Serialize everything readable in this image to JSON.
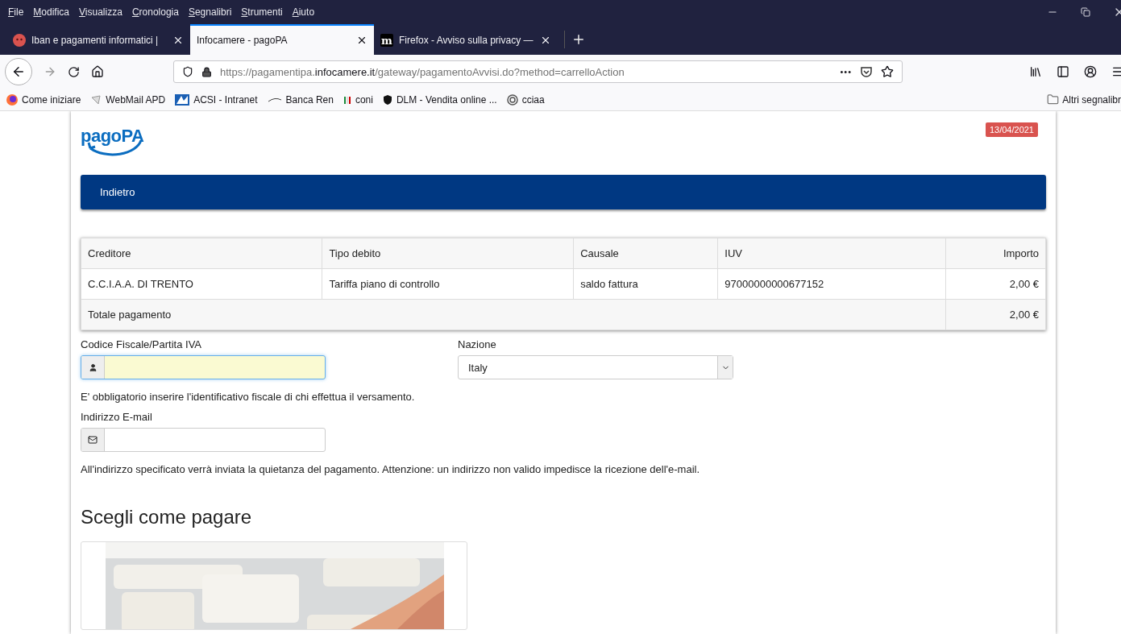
{
  "menu_bar": [
    "File",
    "Modifica",
    "Visualizza",
    "Cronologia",
    "Segnalibri",
    "Strumenti",
    "Aiuto"
  ],
  "tabs": [
    {
      "title": "Iban e pagamenti informatici | ",
      "selected": false,
      "kind": "emoji"
    },
    {
      "title": "Infocamere - pagoPA",
      "selected": true,
      "kind": "none"
    },
    {
      "title": "Firefox - Avviso sulla privacy —",
      "selected": false,
      "kind": "letter",
      "favicon": "m"
    }
  ],
  "address_bar": {
    "url_prefix": "https://pagamentipa.",
    "url_domain": "infocamere.it",
    "url_path": "/gateway/pagamentoAvvisi.do?method=carrelloAction",
    "more": "•••"
  },
  "bookmarks": [
    {
      "label": "Come iniziare",
      "kind": "firefox"
    },
    {
      "label": "WebMail APD",
      "kind": "mail"
    },
    {
      "label": "ACSI - Intranet",
      "kind": "acsi"
    },
    {
      "label": "Banca Ren",
      "kind": "wave"
    },
    {
      "label": "coni",
      "kind": "coni"
    },
    {
      "label": "DLM - Vendita online ...",
      "kind": "shield"
    },
    {
      "label": "cciaa",
      "kind": "spiral"
    }
  ],
  "other_bookmarks": "Altri segnalibr",
  "page": {
    "date": "13/04/2021",
    "logo": "pagoPA",
    "back": "Indietro",
    "table": {
      "columns": [
        "Creditore",
        "Tipo debito",
        "Causale",
        "IUV",
        "Importo"
      ],
      "rows": [
        [
          "C.C.I.A.A. DI TRENTO",
          "Tariffa piano di controllo",
          "saldo fattura",
          "97000000000677152",
          "2,00 €"
        ]
      ],
      "total_label": "Totale pagamento",
      "total_amount": "2,00 €"
    },
    "fiscal_label": "Codice Fiscale/Partita IVA",
    "nation_label": "Nazione",
    "nation_value": "Italy",
    "fiscal_help": "E' obbligatorio inserire l'identificativo fiscale di chi effettua il versamento.",
    "email_label": "Indirizzo E-mail",
    "email_help": "All'indirizzo specificato verrà inviata la quietanza del pagamento. Attenzione: un indirizzo non valido impedisce la ricezione dell'e-mail.",
    "heading": "Scegli come pagare"
  }
}
